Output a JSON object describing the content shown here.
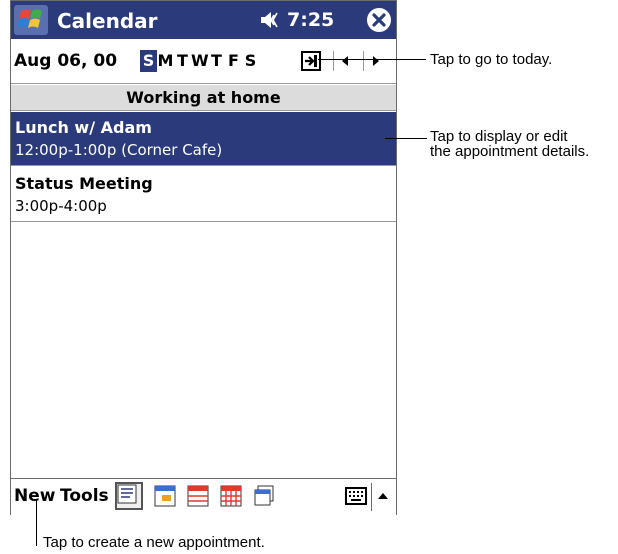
{
  "titlebar": {
    "app_title": "Calendar",
    "time": "7:25",
    "icons": [
      "windows-start-icon",
      "speaker-icon",
      "close-icon"
    ]
  },
  "navbar": {
    "date": "Aug 06, 00",
    "days": [
      "S",
      "M",
      "T",
      "W",
      "T",
      "F",
      "S"
    ],
    "selected_day_index": 0,
    "icons": [
      "go-to-today-icon",
      "previous-arrow-icon",
      "next-arrow-icon"
    ]
  },
  "all_day_event": "Working at home",
  "appointments": [
    {
      "title": "Lunch w/ Adam",
      "details": "12:00p-1:00p (Corner Cafe)",
      "selected": true
    },
    {
      "title": "Status Meeting",
      "details": "3:00p-4:00p",
      "selected": false
    }
  ],
  "command_bar": {
    "new_label": "New",
    "tools_label": "Tools",
    "view_icons": [
      "agenda-view-icon",
      "day-view-icon",
      "week-view-icon",
      "month-view-icon",
      "year-view-icon"
    ],
    "icons": [
      "keyboard-icon",
      "input-panel-arrow-icon"
    ]
  },
  "callouts": {
    "today": "Tap to go to today.",
    "details_line1": "Tap to display or edit",
    "details_line2": "the appointment details.",
    "new_appointment": "Tap to create a new appointment."
  },
  "colors": {
    "titlebar_bg": "#2b3a7a",
    "selection_bg": "#2b3a7a",
    "allday_bg": "#dcdcdc"
  }
}
